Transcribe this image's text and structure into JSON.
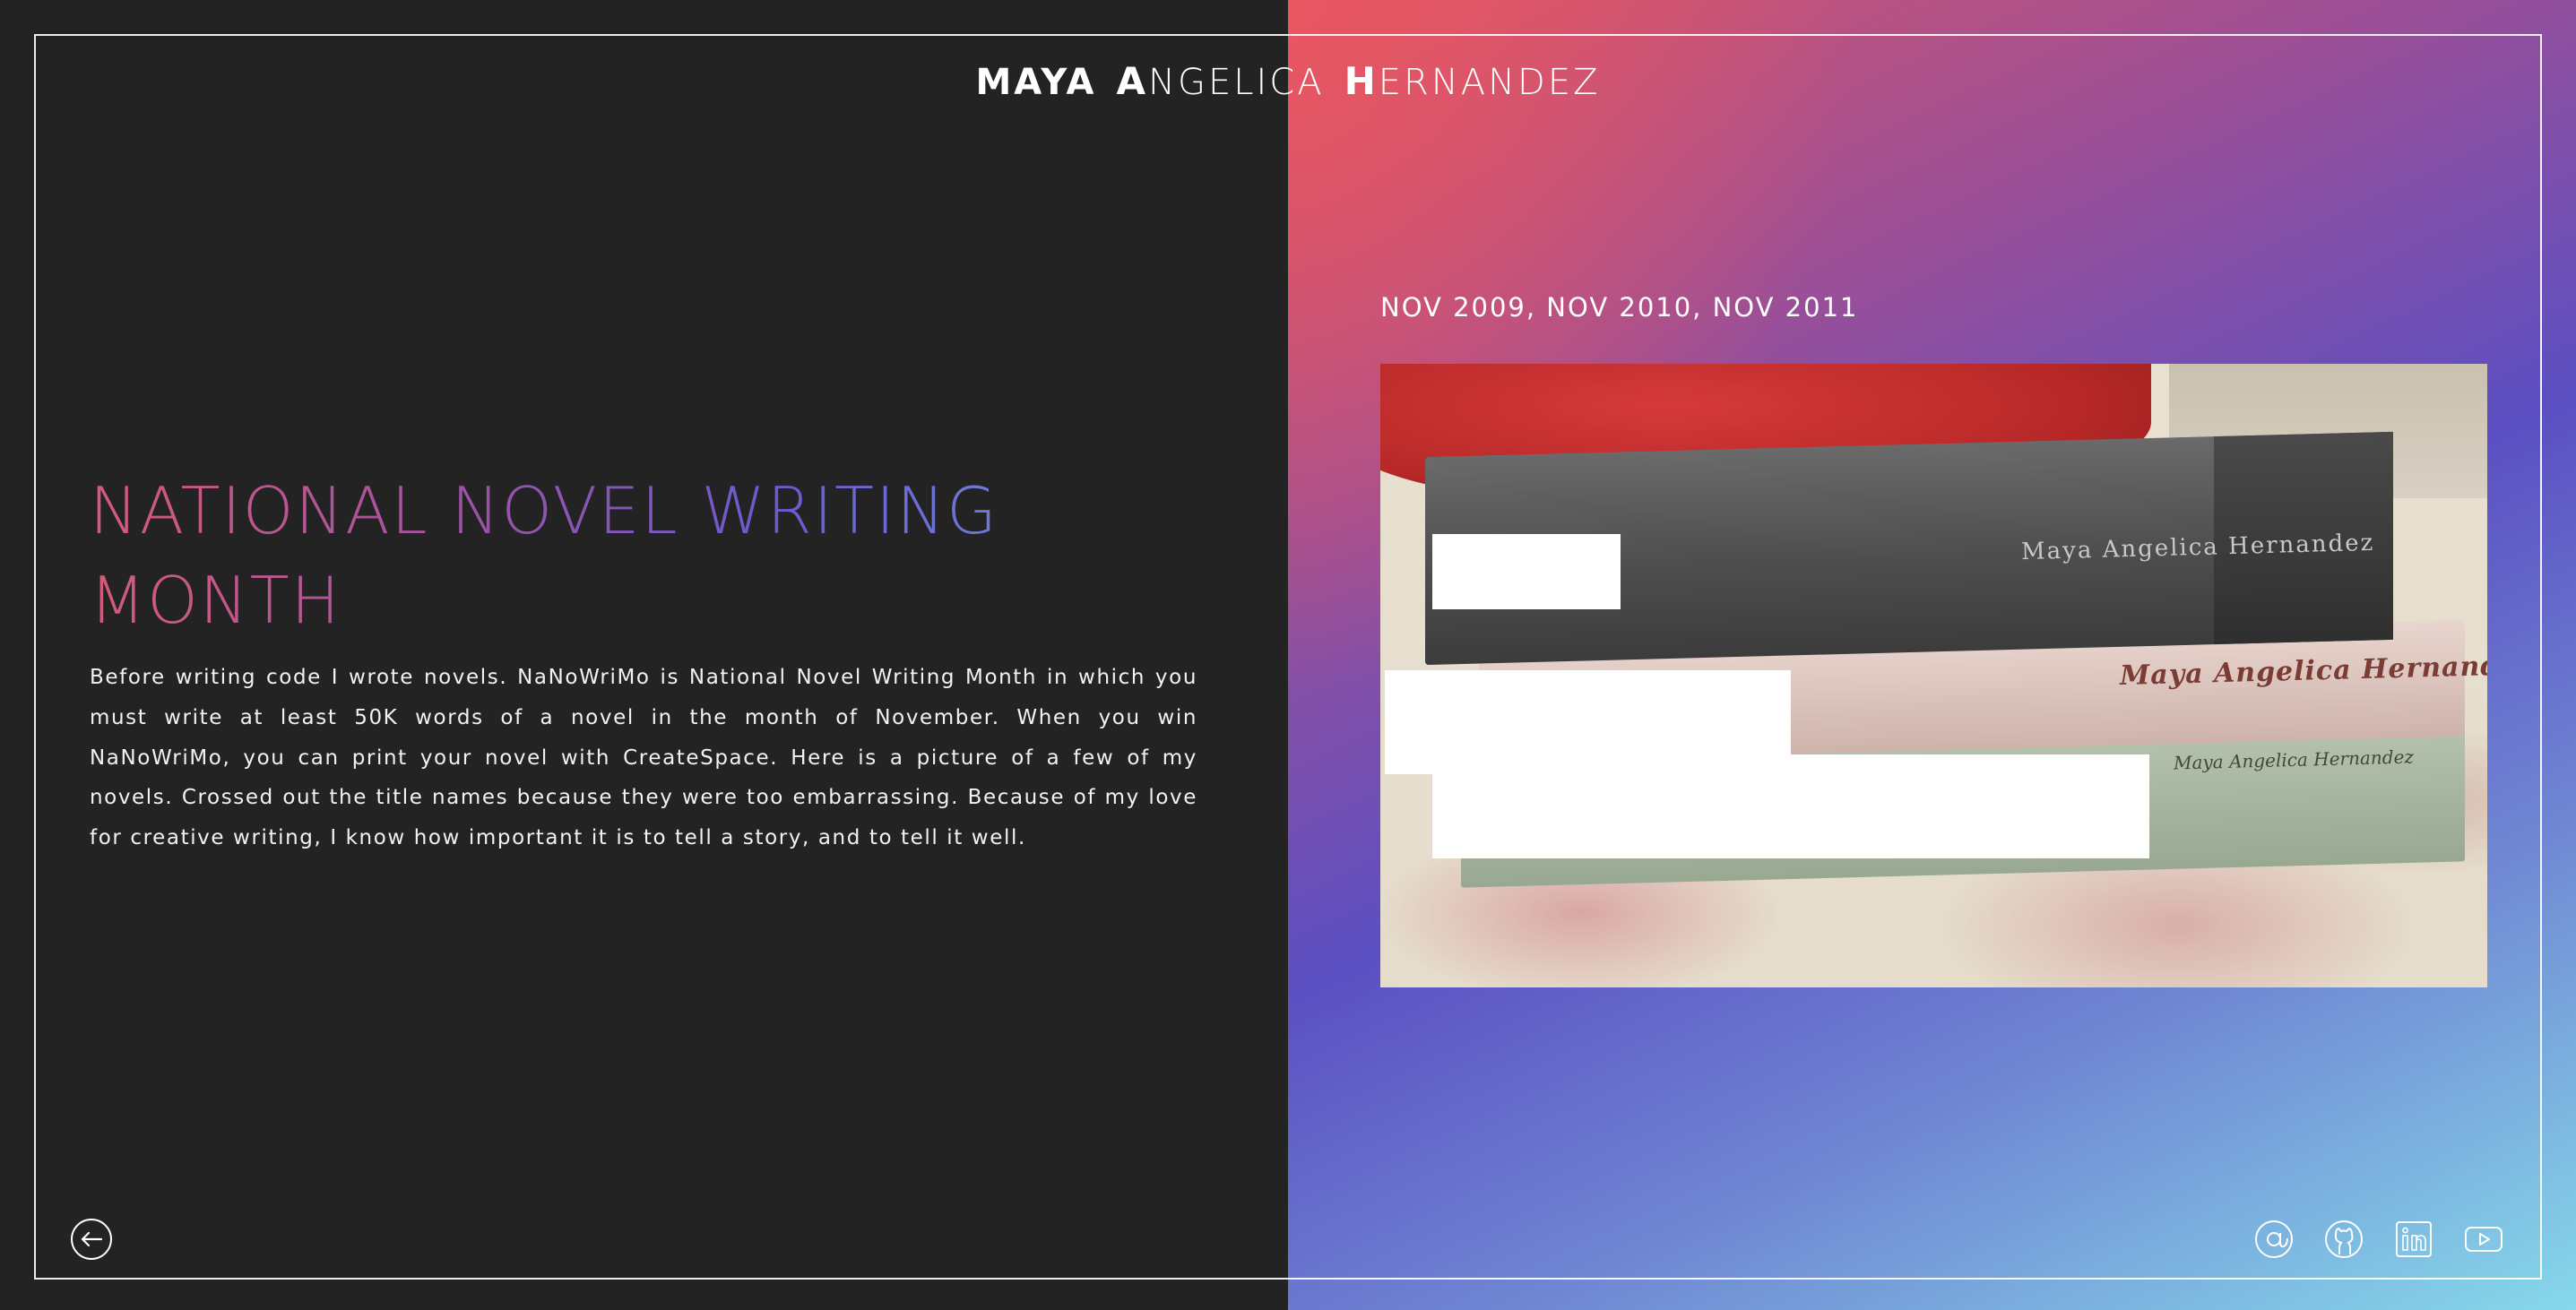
{
  "header": {
    "name_parts": [
      {
        "first": "MAYA"
      },
      {
        "initial": "A",
        "rest": "NGELICA"
      },
      {
        "initial": "H",
        "rest": "ERNANDEZ"
      }
    ]
  },
  "project": {
    "title": "NATIONAL NOVEL WRITING MONTH",
    "description": "Before writing code I wrote novels. NaNoWriMo is National Novel Writing Month in which you must write at least 50K words of a novel in the month of November. When you win NaNoWriMo, you can print your novel with CreateSpace. Here is a picture of a few of my novels. Crossed out the title names because they were too embarrassing. Because of my love for creative writing, I know how important it is to tell a story, and to tell it well.",
    "dates": "NOV 2009, NOV 2010, NOV 2011",
    "photo": {
      "spine_labels": [
        "Maya Angelica Hernandez",
        "Maya Angelica Hernandez",
        "Maya Angelica Hernandez"
      ]
    }
  },
  "footer": {
    "back_icon": "arrow-left-circle-icon",
    "social": [
      {
        "name": "email-icon"
      },
      {
        "name": "github-icon"
      },
      {
        "name": "linkedin-icon"
      },
      {
        "name": "youtube-icon"
      }
    ]
  },
  "colors": {
    "background": "#232323",
    "frame": "#ffffff",
    "gradient": [
      "#d9566a",
      "#9a4f98",
      "#5b4fc2",
      "#6f86d3",
      "#86d8ea"
    ],
    "title_gradient": [
      "#d65a7a",
      "#9a52a8",
      "#6a5bd0",
      "#6c86da"
    ]
  }
}
